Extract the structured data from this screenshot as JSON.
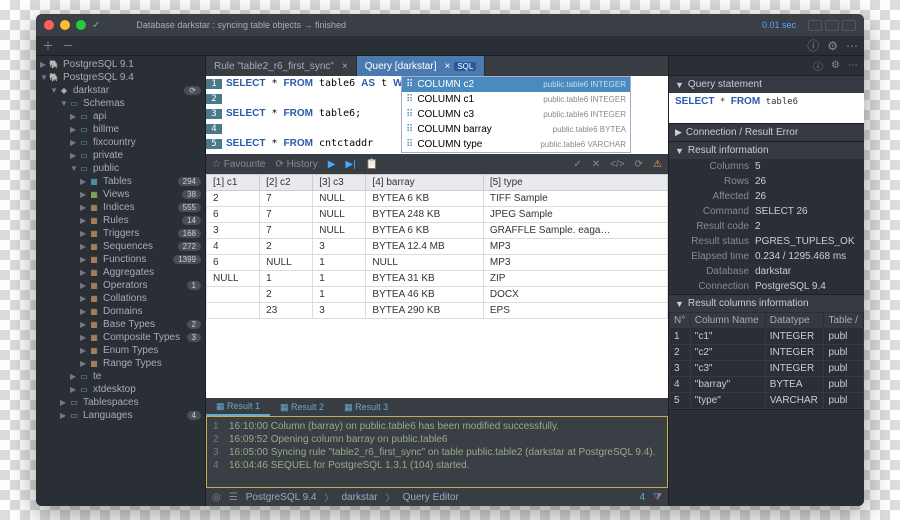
{
  "titlebar": {
    "status": "Database darkstar : syncing table objects → finished",
    "timing": "0.01 sec"
  },
  "sidebar": {
    "servers": [
      {
        "label": "PostgreSQL 9.1",
        "icon": "🐘",
        "indent": 0,
        "disc": "▶",
        "color": "#6ac"
      },
      {
        "label": "PostgreSQL 9.4",
        "icon": "🐘",
        "indent": 0,
        "disc": "▼",
        "color": "#6ac"
      },
      {
        "label": "darkstar",
        "icon": "◆",
        "indent": 1,
        "disc": "▼",
        "color": "#aaa",
        "badge": "⟳"
      },
      {
        "label": "Schemas",
        "icon": "▭",
        "indent": 2,
        "disc": "▼",
        "color": "#6ac"
      },
      {
        "label": "api",
        "icon": "▭",
        "indent": 3,
        "disc": "▶",
        "color": "#6ac"
      },
      {
        "label": "billme",
        "icon": "▭",
        "indent": 3,
        "disc": "▶",
        "color": "#6ac"
      },
      {
        "label": "fixcountry",
        "icon": "▭",
        "indent": 3,
        "disc": "▶",
        "color": "#6ac"
      },
      {
        "label": "private",
        "icon": "▭",
        "indent": 3,
        "disc": "▶",
        "color": "#6ac"
      },
      {
        "label": "public",
        "icon": "▭",
        "indent": 3,
        "disc": "▼",
        "color": "#6ac"
      },
      {
        "label": "Tables",
        "icon": "▦",
        "indent": 4,
        "disc": "▶",
        "color": "#6ac",
        "badge": "294"
      },
      {
        "label": "Views",
        "icon": "▦",
        "indent": 4,
        "disc": "▶",
        "color": "#9c6",
        "badge": "38"
      },
      {
        "label": "Indices",
        "icon": "▦",
        "indent": 4,
        "disc": "▶",
        "color": "#c96",
        "badge": "555"
      },
      {
        "label": "Rules",
        "icon": "▦",
        "indent": 4,
        "disc": "▶",
        "color": "#c96",
        "badge": "14"
      },
      {
        "label": "Triggers",
        "icon": "▦",
        "indent": 4,
        "disc": "▶",
        "color": "#c96",
        "badge": "168"
      },
      {
        "label": "Sequences",
        "icon": "▦",
        "indent": 4,
        "disc": "▶",
        "color": "#c96",
        "badge": "272"
      },
      {
        "label": "Functions",
        "icon": "▦",
        "indent": 4,
        "disc": "▶",
        "color": "#c96",
        "badge": "1399"
      },
      {
        "label": "Aggregates",
        "icon": "▦",
        "indent": 4,
        "disc": "▶",
        "color": "#c96"
      },
      {
        "label": "Operators",
        "icon": "▦",
        "indent": 4,
        "disc": "▶",
        "color": "#c96",
        "badge": "1"
      },
      {
        "label": "Collations",
        "icon": "▦",
        "indent": 4,
        "disc": "▶",
        "color": "#c96"
      },
      {
        "label": "Domains",
        "icon": "▦",
        "indent": 4,
        "disc": "▶",
        "color": "#c96"
      },
      {
        "label": "Base Types",
        "icon": "▦",
        "indent": 4,
        "disc": "▶",
        "color": "#c96",
        "badge": "2"
      },
      {
        "label": "Composite Types",
        "icon": "▦",
        "indent": 4,
        "disc": "▶",
        "color": "#c96",
        "badge": "3"
      },
      {
        "label": "Enum Types",
        "icon": "▦",
        "indent": 4,
        "disc": "▶",
        "color": "#c96"
      },
      {
        "label": "Range Types",
        "icon": "▦",
        "indent": 4,
        "disc": "▶",
        "color": "#c96"
      },
      {
        "label": "te",
        "icon": "▭",
        "indent": 3,
        "disc": "▶",
        "color": "#6ac"
      },
      {
        "label": "xtdesktop",
        "icon": "▭",
        "indent": 3,
        "disc": "▶",
        "color": "#6ac"
      },
      {
        "label": "Tablespaces",
        "icon": "▭",
        "indent": 2,
        "disc": "▶",
        "color": "#aaa"
      },
      {
        "label": "Languages",
        "icon": "▭",
        "indent": 2,
        "disc": "▶",
        "color": "#aaa",
        "badge": "4"
      }
    ]
  },
  "tabs": [
    {
      "label": "Rule \"table2_r6_first_sync\"",
      "active": false
    },
    {
      "label": "Query [darkstar]",
      "active": true,
      "sql": true
    }
  ],
  "editor": {
    "lines": [
      {
        "n": "1",
        "sql": "SELECT * FROM table6 AS t WHERE t. = 'ERROR';"
      },
      {
        "n": "2",
        "sql": ""
      },
      {
        "n": "3",
        "sql": "SELECT * FROM table6;"
      },
      {
        "n": "4",
        "sql": ""
      },
      {
        "n": "5",
        "sql": "SELECT * FROM cntctaddr"
      }
    ]
  },
  "autocomplete": [
    {
      "label": "COLUMN c2",
      "meta": "public.table6",
      "type": "INTEGER",
      "sel": true
    },
    {
      "label": "COLUMN c1",
      "meta": "public.table6",
      "type": "INTEGER"
    },
    {
      "label": "COLUMN c3",
      "meta": "public.table6",
      "type": "INTEGER"
    },
    {
      "label": "COLUMN barray",
      "meta": "public.table6",
      "type": "BYTEA"
    },
    {
      "label": "COLUMN type",
      "meta": "public.table6",
      "type": "VARCHAR"
    }
  ],
  "midbar": {
    "fav": "☆ Favourite",
    "hist": "⟳ History"
  },
  "results": {
    "headers": [
      "[1] c1",
      "[2] c2",
      "[3] c3",
      "[4] barray",
      "[5] type"
    ],
    "rows": [
      [
        "2",
        "7",
        "NULL",
        "BYTEA 6 KB",
        "TIFF Sample"
      ],
      [
        "6",
        "7",
        "NULL",
        "BYTEA 248 KB",
        "JPEG Sample"
      ],
      [
        "3",
        "7",
        "NULL",
        "BYTEA 6 KB",
        "GRAFFLE Sample. eaga…"
      ],
      [
        "4",
        "2",
        "3",
        "BYTEA 12.4 MB",
        "MP3"
      ],
      [
        "6",
        "NULL",
        "1",
        "NULL",
        "MP3"
      ],
      [
        "NULL",
        "1",
        "1",
        "BYTEA 31 KB",
        "ZIP"
      ],
      [
        "",
        "2",
        "1",
        "BYTEA 46 KB",
        "DOCX"
      ],
      [
        "",
        "23",
        "3",
        "BYTEA 290 KB",
        "EPS"
      ]
    ]
  },
  "rtabs": [
    "Result 1",
    "Result 2",
    "Result 3"
  ],
  "log": [
    "16:10:00 Column (barray) on public.table6 has been modified successfully.",
    "16:09:52 Opening column barray on public.table6",
    "16:05:00 Syncing rule \"table2_r6_first_sync\" on table public.table2 (darkstar at PostgreSQL 9.4).",
    "16:04:46 SEQUEL for PostgreSQL 1.3.1 (104) started."
  ],
  "breadcrumb": [
    "PostgreSQL 9.4",
    "darkstar",
    "Query Editor"
  ],
  "breadcrumb_count": "4",
  "right": {
    "query_head": "Query statement",
    "query": "SELECT * FROM table6",
    "conn_head": "Connection / Result Error",
    "info_head": "Result information",
    "info": [
      {
        "k": "Columns",
        "v": "5"
      },
      {
        "k": "Rows",
        "v": "26"
      },
      {
        "k": "Affected",
        "v": "26"
      },
      {
        "k": "Command",
        "v": "SELECT 26"
      },
      {
        "k": "Result code",
        "v": "2"
      },
      {
        "k": "Result status",
        "v": "PGRES_TUPLES_OK"
      },
      {
        "k": "Elapsed time",
        "v": "0.234 / 1295.468 ms"
      },
      {
        "k": "Database",
        "v": "darkstar"
      },
      {
        "k": "Connection",
        "v": "PostgreSQL 9.4"
      }
    ],
    "cols_head": "Result columns information",
    "cols_headers": [
      "N°",
      "Column Name",
      "Datatype",
      "Table /"
    ],
    "cols": [
      [
        "1",
        "\"c1\"",
        "INTEGER",
        "publ"
      ],
      [
        "2",
        "\"c2\"",
        "INTEGER",
        "publ"
      ],
      [
        "3",
        "\"c3\"",
        "INTEGER",
        "publ"
      ],
      [
        "4",
        "\"barray\"",
        "BYTEA",
        "publ"
      ],
      [
        "5",
        "\"type\"",
        "VARCHAR",
        "publ"
      ]
    ]
  }
}
